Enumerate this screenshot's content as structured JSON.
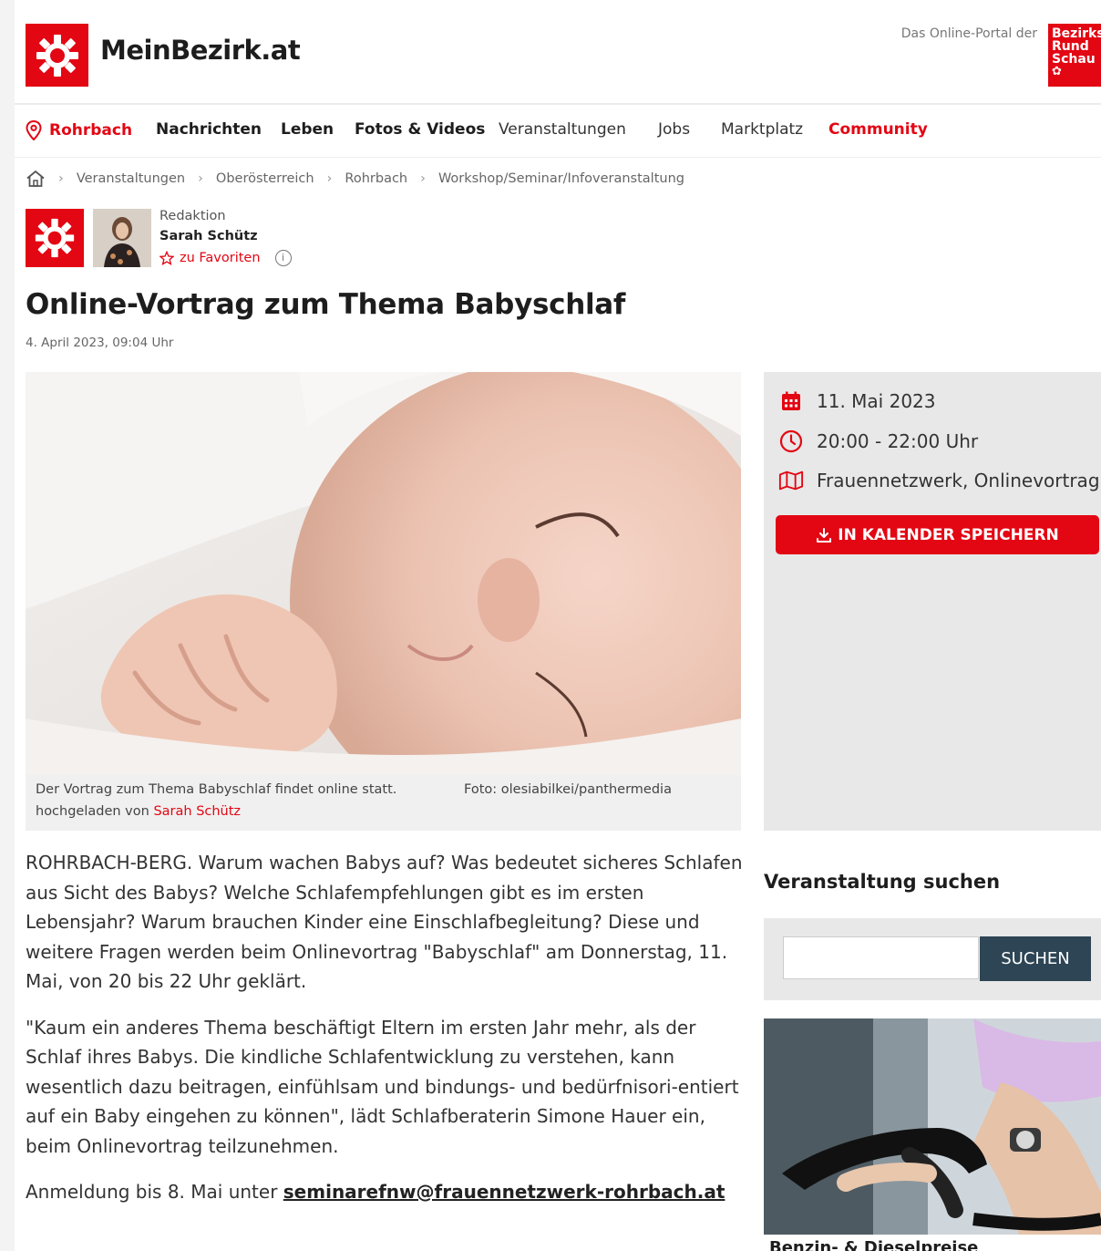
{
  "header": {
    "logo_text": "MeinBezirk.at",
    "portal_text": "Das Online-Portal der",
    "brand_logo_lines": [
      "Bezirks",
      "Rund",
      "Schau"
    ]
  },
  "nav": {
    "location": "Rohrbach",
    "items": [
      "Nachrichten",
      "Leben",
      "Fotos & Videos",
      "Veranstaltungen",
      "Jobs",
      "Marktplatz",
      "Community"
    ]
  },
  "breadcrumb": [
    "Veranstaltungen",
    "Oberösterreich",
    "Rohrbach",
    "Workshop/Seminar/Infoveranstaltung"
  ],
  "author": {
    "label": "Redaktion",
    "name": "Sarah Schütz",
    "favorite_label": "zu Favoriten"
  },
  "article": {
    "title": "Online-Vortrag zum Thema Babyschlaf",
    "date": "4. April 2023, 09:04 Uhr",
    "caption": "Der Vortrag zum Thema Babyschlaf findet online statt.",
    "photo_credit": "Foto: olesiabilkei/panthermedia",
    "uploaded_prefix": "hochgeladen von",
    "uploaded_by": "Sarah Schütz",
    "paragraph1": "ROHRBACH-BERG. Warum wachen Babys auf? Was bedeutet sicheres Schlafen aus Sicht des Babys? Welche Schlafempfehlungen gibt es im ersten Lebensjahr? Warum brauchen Kinder eine Einschlafbegleitung? Diese und weitere Fragen werden beim Onlinevortrag \"Babyschlaf\" am Donnerstag, 11. Mai, von 20 bis 22 Uhr geklärt.",
    "paragraph2": "\"Kaum ein anderes Thema beschäftigt Eltern im ersten Jahr mehr, als der Schlaf ihres Babys. Die kindliche Schlafentwicklung zu verstehen, kann wesentlich dazu beitragen, einfühlsam und bindungs- und bedürfnisori-entiert auf ein Baby eingehen zu können\", lädt Schlafberaterin Simone Hauer ein, beim Onlinevortrag teilzunehmen.",
    "paragraph3_prefix": "Anmeldung bis 8. Mai unter",
    "email": "seminarefnw@frauennetzwerk-rohrbach.at"
  },
  "event": {
    "date": "11. Mai 2023",
    "time": "20:00 - 22:00 Uhr",
    "location": "Frauennetzwerk, Onlinevortrag",
    "calendar_button": "IN KALENDER SPEICHERN"
  },
  "search": {
    "title": "Veranstaltung suchen",
    "placeholder": "",
    "button": "SUCHEN"
  },
  "teaser": {
    "caption": "Benzin- & Dieselpreise"
  },
  "colors": {
    "brand_red": "#e30613",
    "search_button": "#2d4554",
    "sidebar_bg": "#e8e8e8"
  }
}
